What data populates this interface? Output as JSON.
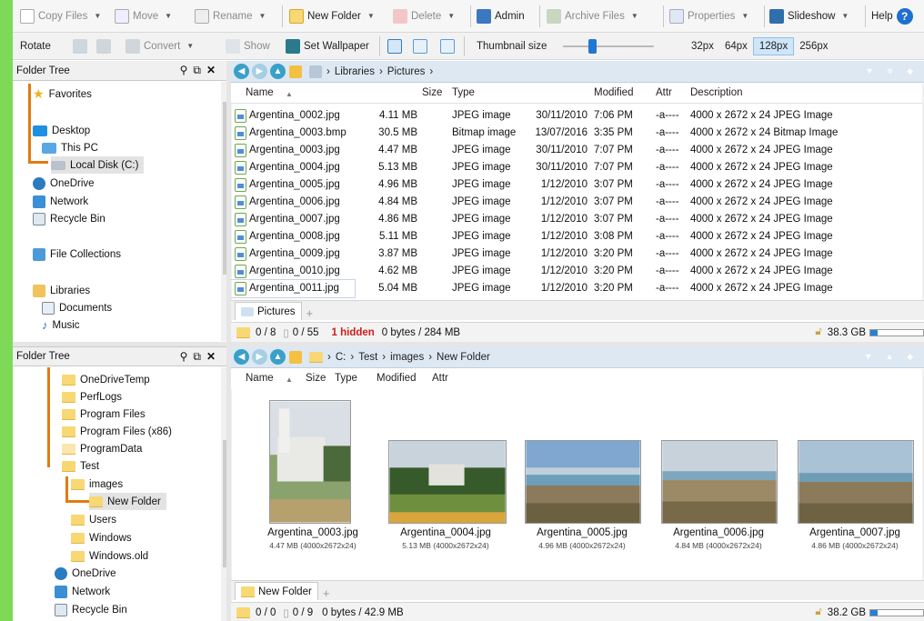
{
  "toolbar1": {
    "copy": "Copy Files",
    "move": "Move",
    "rename": "Rename",
    "newfolder": "New Folder",
    "delete": "Delete",
    "admin": "Admin",
    "archive": "Archive Files",
    "properties": "Properties",
    "slideshow": "Slideshow",
    "help": "Help"
  },
  "toolbar2": {
    "rotate": "Rotate",
    "convert": "Convert",
    "show": "Show",
    "wallpaper": "Set Wallpaper",
    "thumbsize": "Thumbnail size",
    "sizes": [
      "32px",
      "64px",
      "128px",
      "256px"
    ],
    "selected_size": "128px",
    "slider_pos": 0.28
  },
  "top": {
    "tree_title": "Folder Tree",
    "tree": [
      {
        "label": "Favorites",
        "icon": "star"
      },
      {
        "label": "Desktop",
        "icon": "desktop"
      },
      {
        "label": "This PC",
        "icon": "pc"
      },
      {
        "label": "Local Disk (C:)",
        "icon": "disk"
      },
      {
        "label": "OneDrive",
        "icon": "cloud"
      },
      {
        "label": "Network",
        "icon": "network"
      },
      {
        "label": "Recycle Bin",
        "icon": "bin"
      },
      {
        "label": "File Collections",
        "icon": "collections"
      },
      {
        "label": "Libraries",
        "icon": "libraries"
      },
      {
        "label": "Documents",
        "icon": "documents"
      },
      {
        "label": "Music",
        "icon": "music"
      }
    ],
    "crumbs": [
      "Libraries",
      "Pictures"
    ],
    "columns": [
      "Name",
      "Size",
      "Type",
      "Modified",
      "Attr",
      "Description"
    ],
    "rows": [
      {
        "name": "Argentina_0002.jpg",
        "size": "4.11 MB",
        "type": "JPEG image",
        "date": "30/11/2010",
        "time": "7:06 PM",
        "attr": "-a----",
        "desc": "4000 x 2672 x 24 JPEG Image"
      },
      {
        "name": "Argentina_0003.bmp",
        "size": "30.5 MB",
        "type": "Bitmap image",
        "date": "13/07/2016",
        "time": "3:35 PM",
        "attr": "-a----",
        "desc": "4000 x 2672 x 24 Bitmap Image"
      },
      {
        "name": "Argentina_0003.jpg",
        "size": "4.47 MB",
        "type": "JPEG image",
        "date": "30/11/2010",
        "time": "7:07 PM",
        "attr": "-a----",
        "desc": "4000 x 2672 x 24 JPEG Image"
      },
      {
        "name": "Argentina_0004.jpg",
        "size": "5.13 MB",
        "type": "JPEG image",
        "date": "30/11/2010",
        "time": "7:07 PM",
        "attr": "-a----",
        "desc": "4000 x 2672 x 24 JPEG Image"
      },
      {
        "name": "Argentina_0005.jpg",
        "size": "4.96 MB",
        "type": "JPEG image",
        "date": "1/12/2010",
        "time": "3:07 PM",
        "attr": "-a----",
        "desc": "4000 x 2672 x 24 JPEG Image"
      },
      {
        "name": "Argentina_0006.jpg",
        "size": "4.84 MB",
        "type": "JPEG image",
        "date": "1/12/2010",
        "time": "3:07 PM",
        "attr": "-a----",
        "desc": "4000 x 2672 x 24 JPEG Image"
      },
      {
        "name": "Argentina_0007.jpg",
        "size": "4.86 MB",
        "type": "JPEG image",
        "date": "1/12/2010",
        "time": "3:07 PM",
        "attr": "-a----",
        "desc": "4000 x 2672 x 24 JPEG Image"
      },
      {
        "name": "Argentina_0008.jpg",
        "size": "5.11 MB",
        "type": "JPEG image",
        "date": "1/12/2010",
        "time": "3:08 PM",
        "attr": "-a----",
        "desc": "4000 x 2672 x 24 JPEG Image"
      },
      {
        "name": "Argentina_0009.jpg",
        "size": "3.87 MB",
        "type": "JPEG image",
        "date": "1/12/2010",
        "time": "3:20 PM",
        "attr": "-a----",
        "desc": "4000 x 2672 x 24 JPEG Image"
      },
      {
        "name": "Argentina_0010.jpg",
        "size": "4.62 MB",
        "type": "JPEG image",
        "date": "1/12/2010",
        "time": "3:20 PM",
        "attr": "-a----",
        "desc": "4000 x 2672 x 24 JPEG Image"
      },
      {
        "name": "Argentina_0011.jpg",
        "size": "5.04 MB",
        "type": "JPEG image",
        "date": "1/12/2010",
        "time": "3:20 PM",
        "attr": "-a----",
        "desc": "4000 x 2672 x 24 JPEG Image"
      }
    ],
    "tab": "Pictures",
    "status": {
      "folders": "0 / 8",
      "files": "0 / 55",
      "hidden": "1 hidden",
      "bytes": "0 bytes / 284 MB",
      "free": "38.3 GB"
    }
  },
  "bottom": {
    "tree_title": "Folder Tree",
    "tree": [
      {
        "label": "OneDriveTemp"
      },
      {
        "label": "PerfLogs"
      },
      {
        "label": "Program Files"
      },
      {
        "label": "Program Files (x86)"
      },
      {
        "label": "ProgramData"
      },
      {
        "label": "Test"
      },
      {
        "label": "images"
      },
      {
        "label": "New Folder"
      },
      {
        "label": "Users"
      },
      {
        "label": "Windows"
      },
      {
        "label": "Windows.old"
      },
      {
        "label": "OneDrive"
      },
      {
        "label": "Network"
      },
      {
        "label": "Recycle Bin"
      }
    ],
    "crumbs": [
      "C:",
      "Test",
      "images",
      "New Folder"
    ],
    "columns": [
      "Name",
      "Size",
      "Type",
      "Modified",
      "Attr"
    ],
    "thumbs": [
      {
        "name": "Argentina_0003.jpg",
        "info": "4.47 MB (4000x2672x24)"
      },
      {
        "name": "Argentina_0004.jpg",
        "info": "5.13 MB (4000x2672x24)"
      },
      {
        "name": "Argentina_0005.jpg",
        "info": "4.96 MB (4000x2672x24)"
      },
      {
        "name": "Argentina_0006.jpg",
        "info": "4.84 MB (4000x2672x24)"
      },
      {
        "name": "Argentina_0007.jpg",
        "info": "4.86 MB (4000x2672x24)"
      }
    ],
    "tab": "New Folder",
    "status": {
      "folders": "0 / 0",
      "files": "0 / 9",
      "bytes": "0 bytes / 42.9 MB",
      "free": "38.2 GB"
    }
  }
}
